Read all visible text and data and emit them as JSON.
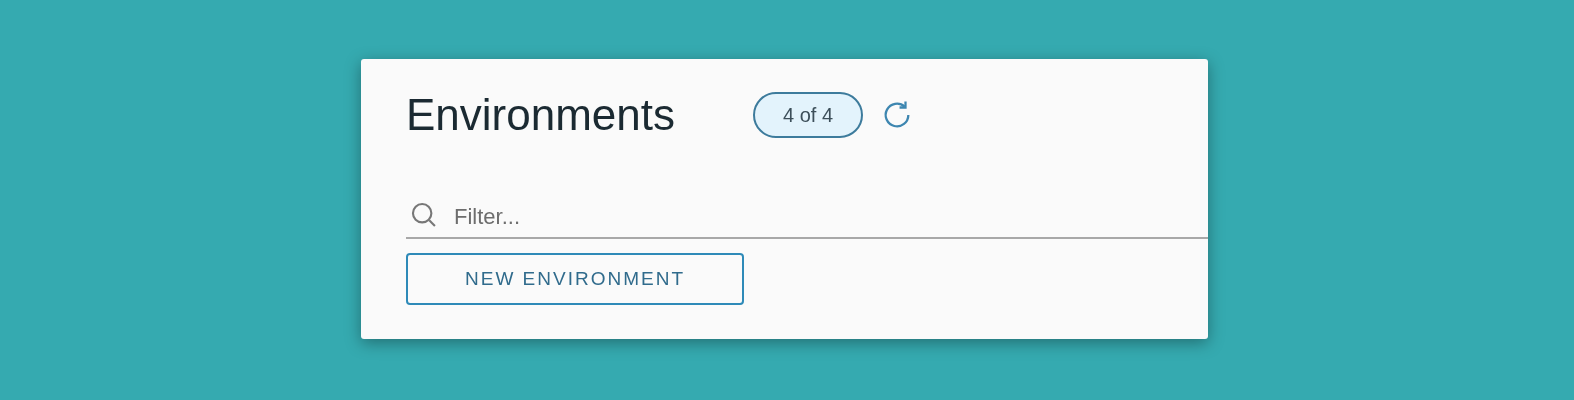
{
  "header": {
    "title": "Environments",
    "count_badge": "4 of 4"
  },
  "filter": {
    "placeholder": "Filter..."
  },
  "buttons": [
    "NEW ENVIRONMENT"
  ]
}
